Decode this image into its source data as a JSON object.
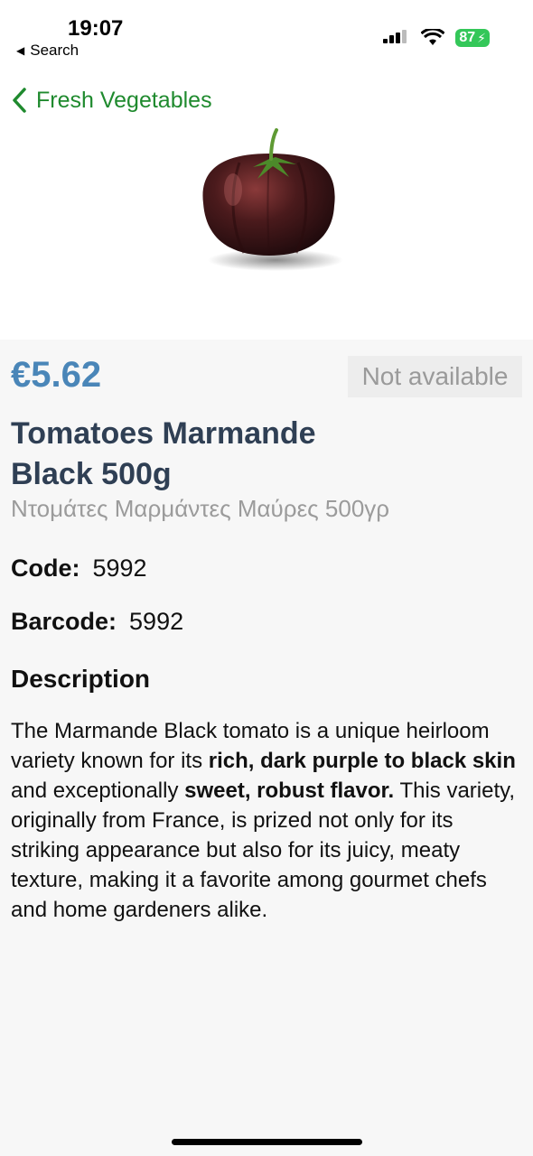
{
  "status_bar": {
    "time": "19:07",
    "back_app_label": "Search",
    "battery_level": "87",
    "icons": [
      "signal-icon",
      "wifi-icon",
      "battery-icon"
    ]
  },
  "nav": {
    "back_label": "Fresh Vegetables",
    "accent_color": "#1f8a2e"
  },
  "product": {
    "image_subject": "black-marmande-tomato",
    "price": "€5.62",
    "price_color": "#4a86b8",
    "availability": "Not available",
    "title": "Tomatoes Marmande Black 500g",
    "subtitle": "Ντομάτες Μαρμάντες Μαύρες 500γρ",
    "code_label": "Code:",
    "code_value": "5992",
    "barcode_label": "Barcode:",
    "barcode_value": "5992",
    "description_heading": "Description",
    "description": {
      "p1": "The Marmande Black tomato is a unique heirloom variety known for its ",
      "b1": "rich, dark purple to black skin",
      "p2": " and exceptionally ",
      "b2": "sweet, robust flavor.",
      "p3": " This variety, originally from France, is prized not only for its striking appearance but also for its juicy, meaty texture, making it a favorite among gourmet chefs and home gardeners alike."
    }
  }
}
